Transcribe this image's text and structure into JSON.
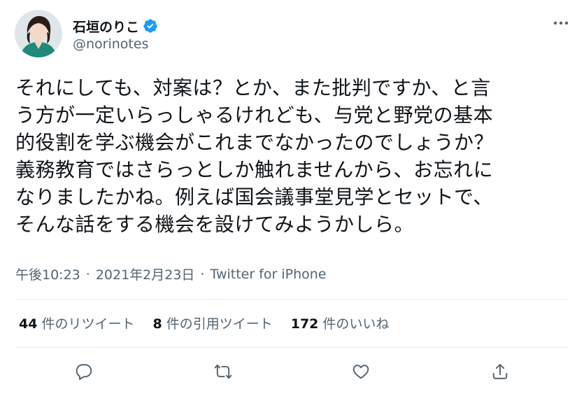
{
  "author": {
    "display_name": "石垣のりこ",
    "handle": "@norinotes",
    "avatar_icon": "avatar",
    "verified_icon": "verified-badge-icon"
  },
  "tweet": {
    "text": "それにしても、対案は？とか、また批判ですか、と言\nう方が一定いらっしゃるけれども、与党と野党の基本\n的役割を学ぶ機会がこれまでなかったのでしょうか？\n義務教育ではさらっとしか触れませんから、お忘れに\nなりましたかね。例えば国会議事堂見学とセットで、\nそんな話をする機会を設けてみようかしら。",
    "time": "午後10:23",
    "date": "2021年2月23日",
    "separator": "·",
    "source": "Twitter for iPhone"
  },
  "stats": {
    "retweets_count": "44",
    "retweets_label": "件のリツイート",
    "quotes_count": "8",
    "quotes_label": "件の引用ツイート",
    "likes_count": "172",
    "likes_label": "件のいいね"
  },
  "colors": {
    "accent": "#1d9bf0",
    "secondary_text": "#536471",
    "primary_text": "#0f1419",
    "divider": "#e6ecf0"
  }
}
